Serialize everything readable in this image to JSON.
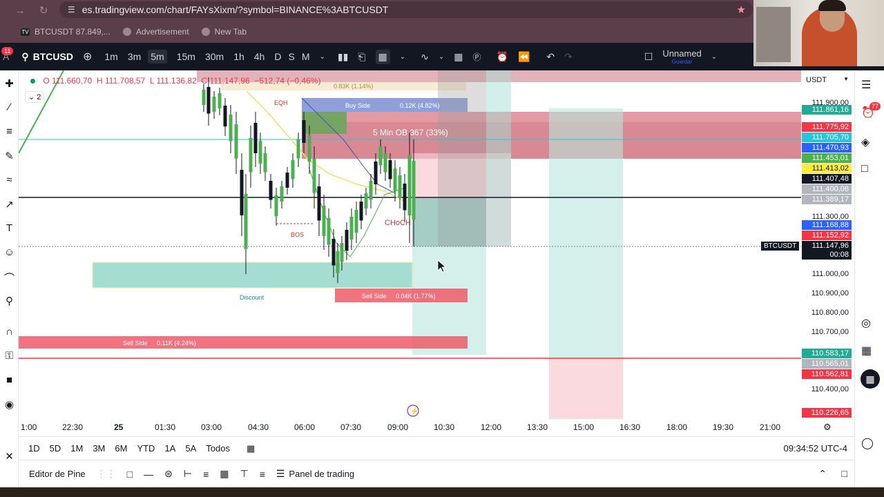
{
  "browser": {
    "url": "es.tradingview.com/chart/FAYsXixm/?symbol=BINANCE%3ABTCUSDT",
    "tabs": [
      {
        "label": "BTCUSDT 87.849,..."
      },
      {
        "label": "Advertisement"
      },
      {
        "label": "New Tab"
      }
    ]
  },
  "toolbar": {
    "symbol": "BTCUSD",
    "notification_count": "11",
    "intervals": [
      "1m",
      "3m",
      "5m",
      "15m",
      "30m",
      "1h",
      "4h",
      "D",
      "S",
      "M"
    ],
    "active_interval": "5m",
    "layout_name": "Unnamed",
    "layout_status": "Guardar"
  },
  "legend": {
    "open": "O 111.660,70",
    "high": "H 111.708,57",
    "low": "L 111.136,82",
    "close": "C 111.147,96",
    "change": "−512,74 (−0,46%)",
    "indicator_count": "2"
  },
  "price_axis": {
    "currency": "USDT",
    "labels": [
      {
        "text": "111.900,00",
        "bg": "",
        "fg": "#131722"
      },
      {
        "text": "111.861,16",
        "bg": "#22ab94",
        "fg": "#ffffff"
      },
      {
        "text": "111.775,92",
        "bg": "#f23645",
        "fg": "#ffffff"
      },
      {
        "text": "111.705,70",
        "bg": "#26c6da",
        "fg": "#ffffff"
      },
      {
        "text": "111.470,93",
        "bg": "#2962ff",
        "fg": "#ffffff"
      },
      {
        "text": "111.453,01",
        "bg": "#4caf50",
        "fg": "#ffffff"
      },
      {
        "text": "111.413,02",
        "bg": "#ffeb3b",
        "fg": "#131722"
      },
      {
        "text": "111.407,48",
        "bg": "#131722",
        "fg": "#ffffff"
      },
      {
        "text": "111.400,06",
        "bg": "#b2b5be",
        "fg": "#ffffff"
      },
      {
        "text": "111.389,17",
        "bg": "#b2b5be",
        "fg": "#ffffff"
      },
      {
        "text": "111.300,00",
        "bg": "",
        "fg": "#131722"
      },
      {
        "text": "111.168,88",
        "bg": "#2962ff",
        "fg": "#ffffff"
      },
      {
        "text": "111.152,92",
        "bg": "#f23645",
        "fg": "#ffffff"
      },
      {
        "text": "111.147,96",
        "bg": "#131722",
        "fg": "#ffffff"
      },
      {
        "text": "00:08",
        "bg": "#131722",
        "fg": "#ffffff"
      },
      {
        "text": "111.000,00",
        "bg": "",
        "fg": "#131722"
      },
      {
        "text": "110.900,00",
        "bg": "",
        "fg": "#131722"
      },
      {
        "text": "110.800,00",
        "bg": "",
        "fg": "#131722"
      },
      {
        "text": "110.700,00",
        "bg": "",
        "fg": "#131722"
      },
      {
        "text": "110.583,17",
        "bg": "#22ab94",
        "fg": "#ffffff"
      },
      {
        "text": "110.565,01",
        "bg": "#b2b5be",
        "fg": "#ffffff"
      },
      {
        "text": "110.562,81",
        "bg": "#f23645",
        "fg": "#ffffff"
      },
      {
        "text": "110.400,00",
        "bg": "",
        "fg": "#131722"
      },
      {
        "text": "110.226,65",
        "bg": "#f23645",
        "fg": "#ffffff"
      }
    ],
    "symbol_tag": "BTCUSDT"
  },
  "annotations": {
    "buy_side": "Buy Side",
    "buy_side_value": "0.12K (4.82%)",
    "ob_label": "5 Min OB 367 (33%)",
    "eqh": "EQH",
    "bos": "BOS",
    "choch": "CHoCH",
    "discount": "Discount",
    "sell_side_1": "Sell Side",
    "sell_side_1_value": "0.04K (1.77%)",
    "sell_side_2": "Sell Side",
    "sell_side_2_value": "0.11K (4.24%)",
    "top_fvg": "0.83K (1.14%)"
  },
  "time_axis": [
    "1:00",
    "22:30",
    "25",
    "01:30",
    "03:00",
    "04:30",
    "06:00",
    "07:30",
    "09:00",
    "10:30",
    "12:00",
    "13:30",
    "15:00",
    "16:30",
    "18:00",
    "19:30",
    "21:00"
  ],
  "range_bar": {
    "ranges": [
      "1D",
      "5D",
      "1M",
      "3M",
      "6M",
      "YTD",
      "1A",
      "5A",
      "Todos"
    ],
    "clock": "09:34:52 UTC-4"
  },
  "bottom_bar": {
    "pine_editor": "Editor de Pine",
    "trading_panel": "Panel de trading"
  },
  "right_rail": {
    "alerts_badge": "77"
  }
}
